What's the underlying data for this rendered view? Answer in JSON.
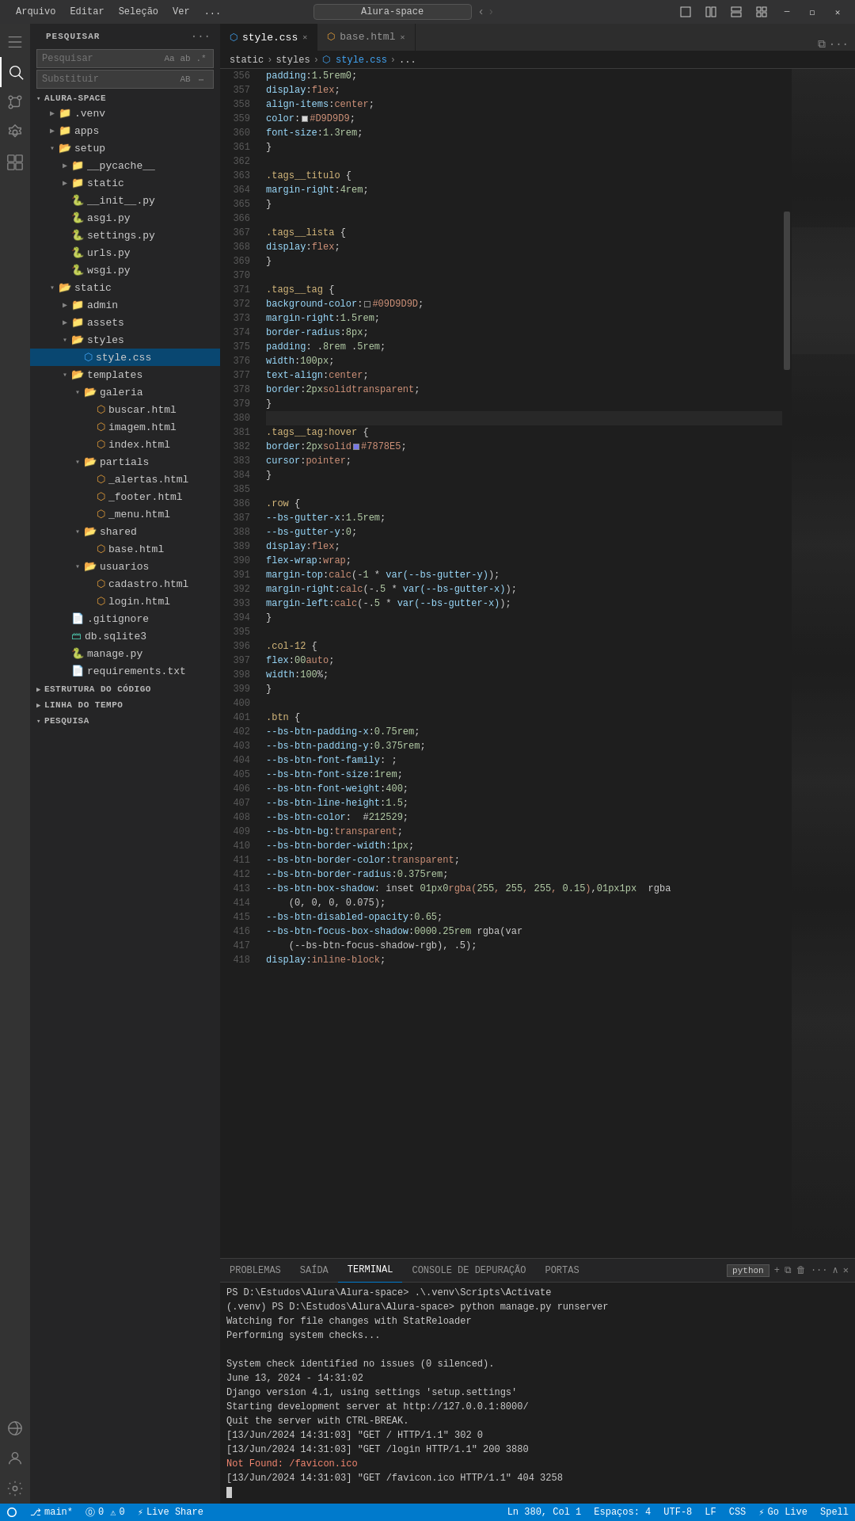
{
  "window": {
    "title": "Alura-space",
    "menu": [
      "Arquivo",
      "Editar",
      "Seleção",
      "Ver",
      "..."
    ]
  },
  "tabs": [
    {
      "id": "style.css",
      "label": "style.css",
      "icon": "css",
      "active": true,
      "dot": false
    },
    {
      "id": "base.html",
      "label": "base.html",
      "icon": "html",
      "active": false,
      "dot": false
    }
  ],
  "breadcrumb": [
    "static",
    "styles",
    "style.css",
    "..."
  ],
  "sidebar": {
    "title": "PESQUISAR",
    "search": {
      "placeholder": "Pesquisar",
      "value": ""
    },
    "replace": {
      "placeholder": "Substituir",
      "value": ""
    },
    "sections": {
      "estrutura": "ESTRUTURA DO CÓDIGO",
      "linha": "LINHA DO TEMPO",
      "pesquisa": "PESQUISA"
    }
  },
  "explorer": {
    "title": "ALURA-SPACE",
    "tree": [
      {
        "indent": 1,
        "open": true,
        "label": ".venv",
        "type": "folder"
      },
      {
        "indent": 1,
        "open": true,
        "label": "apps",
        "type": "folder"
      },
      {
        "indent": 1,
        "open": true,
        "label": "setup",
        "type": "folder"
      },
      {
        "indent": 2,
        "open": true,
        "label": "__pycache__",
        "type": "folder"
      },
      {
        "indent": 2,
        "open": true,
        "label": "static",
        "type": "folder"
      },
      {
        "indent": 2,
        "label": "__init__.py",
        "type": "py"
      },
      {
        "indent": 2,
        "label": "asgi.py",
        "type": "py"
      },
      {
        "indent": 2,
        "label": "settings.py",
        "type": "py"
      },
      {
        "indent": 2,
        "label": "urls.py",
        "type": "py"
      },
      {
        "indent": 2,
        "label": "wsgi.py",
        "type": "py"
      },
      {
        "indent": 1,
        "open": true,
        "label": "static",
        "type": "folder"
      },
      {
        "indent": 2,
        "open": true,
        "label": "admin",
        "type": "folder"
      },
      {
        "indent": 2,
        "open": true,
        "label": "assets",
        "type": "folder"
      },
      {
        "indent": 2,
        "open": true,
        "label": "styles",
        "type": "folder"
      },
      {
        "indent": 3,
        "label": "style.css",
        "type": "css",
        "active": true
      },
      {
        "indent": 2,
        "open": true,
        "label": "templates",
        "type": "folder"
      },
      {
        "indent": 3,
        "open": true,
        "label": "galeria",
        "type": "folder"
      },
      {
        "indent": 4,
        "label": "buscar.html",
        "type": "html"
      },
      {
        "indent": 4,
        "label": "imagem.html",
        "type": "html"
      },
      {
        "indent": 4,
        "label": "index.html",
        "type": "html"
      },
      {
        "indent": 3,
        "open": true,
        "label": "partials",
        "type": "folder"
      },
      {
        "indent": 4,
        "label": "_alertas.html",
        "type": "html"
      },
      {
        "indent": 4,
        "label": "_footer.html",
        "type": "html"
      },
      {
        "indent": 4,
        "label": "_menu.html",
        "type": "html"
      },
      {
        "indent": 3,
        "open": true,
        "label": "shared",
        "type": "folder"
      },
      {
        "indent": 4,
        "label": "base.html",
        "type": "html"
      },
      {
        "indent": 3,
        "open": true,
        "label": "usuarios",
        "type": "folder"
      },
      {
        "indent": 4,
        "label": "cadastro.html",
        "type": "html"
      },
      {
        "indent": 4,
        "label": "login.html",
        "type": "html"
      },
      {
        "indent": 2,
        "label": ".gitignore",
        "type": "file"
      },
      {
        "indent": 2,
        "label": "db.sqlite3",
        "type": "db"
      },
      {
        "indent": 2,
        "label": "manage.py",
        "type": "py"
      },
      {
        "indent": 2,
        "label": "requirements.txt",
        "type": "txt"
      }
    ]
  },
  "code": {
    "lines": [
      {
        "num": 356,
        "content": "  padding: 1.5rem 0;"
      },
      {
        "num": 357,
        "content": "  display: flex;"
      },
      {
        "num": 358,
        "content": "  align-items: center;"
      },
      {
        "num": 359,
        "content": "  color:  #D9D9D9;"
      },
      {
        "num": 360,
        "content": "  font-size: 1.3rem;"
      },
      {
        "num": 361,
        "content": "}"
      },
      {
        "num": 362,
        "content": ""
      },
      {
        "num": 363,
        "content": ".tags__titulo {"
      },
      {
        "num": 364,
        "content": "  margin-right: 4rem;"
      },
      {
        "num": 365,
        "content": "}"
      },
      {
        "num": 366,
        "content": ""
      },
      {
        "num": 367,
        "content": ".tags__lista {"
      },
      {
        "num": 368,
        "content": "  display: flex;"
      },
      {
        "num": 369,
        "content": "}"
      },
      {
        "num": 370,
        "content": ""
      },
      {
        "num": 371,
        "content": ".tags__tag {"
      },
      {
        "num": 372,
        "content": "  background-color:  #09D9D9D;"
      },
      {
        "num": 373,
        "content": "  margin-right: 1.5rem;"
      },
      {
        "num": 374,
        "content": "  border-radius: 8px;"
      },
      {
        "num": 375,
        "content": "  padding: .8rem .5rem;"
      },
      {
        "num": 376,
        "content": "  width: 100px;"
      },
      {
        "num": 377,
        "content": "  text-align: center;"
      },
      {
        "num": 378,
        "content": "  border: 2px solid transparent;"
      },
      {
        "num": 379,
        "content": "}"
      },
      {
        "num": 380,
        "content": ""
      },
      {
        "num": 381,
        "content": ".tags__tag:hover {"
      },
      {
        "num": 382,
        "content": "  border: 2px solid  #7878E5;"
      },
      {
        "num": 383,
        "content": "  cursor: pointer;"
      },
      {
        "num": 384,
        "content": "}"
      },
      {
        "num": 385,
        "content": ""
      },
      {
        "num": 386,
        "content": ".row {"
      },
      {
        "num": 387,
        "content": "  --bs-gutter-x: 1.5rem;"
      },
      {
        "num": 388,
        "content": "  --bs-gutter-y: 0;"
      },
      {
        "num": 389,
        "content": "  display: flex;"
      },
      {
        "num": 390,
        "content": "  flex-wrap: wrap;"
      },
      {
        "num": 391,
        "content": "  margin-top: calc(-1 * var(--bs-gutter-y));"
      },
      {
        "num": 392,
        "content": "  margin-right: calc(-.5 * var(--bs-gutter-x));"
      },
      {
        "num": 393,
        "content": "  margin-left: calc(-.5 * var(--bs-gutter-x));"
      },
      {
        "num": 394,
        "content": "}"
      },
      {
        "num": 395,
        "content": ""
      },
      {
        "num": 396,
        "content": ".col-12 {"
      },
      {
        "num": 397,
        "content": "  flex: 0 0 auto;"
      },
      {
        "num": 398,
        "content": "  width: 100%;"
      },
      {
        "num": 399,
        "content": "}"
      },
      {
        "num": 400,
        "content": ""
      },
      {
        "num": 401,
        "content": ".btn {"
      },
      {
        "num": 402,
        "content": "  --bs-btn-padding-x: 0.75rem;"
      },
      {
        "num": 403,
        "content": "  --bs-btn-padding-y: 0.375rem;"
      },
      {
        "num": 404,
        "content": "  --bs-btn-font-family: ;"
      },
      {
        "num": 405,
        "content": "  --bs-btn-font-size: 1rem;"
      },
      {
        "num": 406,
        "content": "  --bs-btn-font-weight: 400;"
      },
      {
        "num": 407,
        "content": "  --bs-btn-line-height: 1.5;"
      },
      {
        "num": 408,
        "content": "  --bs-btn-color:  #212529;"
      },
      {
        "num": 409,
        "content": "  --bs-btn-bg: transparent;"
      },
      {
        "num": 410,
        "content": "  --bs-btn-border-width: 1px;"
      },
      {
        "num": 411,
        "content": "  --bs-btn-border-color: transparent;"
      },
      {
        "num": 412,
        "content": "  --bs-btn-border-radius: 0.375rem;"
      },
      {
        "num": 413,
        "content": "  --bs-btn-box-shadow: inset 0 1px 0  rgba(255, 255, 255, 0.15),0 1px 1px  rgba"
      },
      {
        "num": 414,
        "content": "    (0, 0, 0, 0.075);"
      },
      {
        "num": 415,
        "content": "  --bs-btn-disabled-opacity: 0.65;"
      },
      {
        "num": 416,
        "content": "  --bs-btn-focus-box-shadow: 0 0 0 0.25rem rgba(var"
      },
      {
        "num": 417,
        "content": "    (--bs-btn-focus-shadow-rgb), .5);"
      },
      {
        "num": 418,
        "content": "  display: inline-block;"
      }
    ]
  },
  "terminal": {
    "tabs": [
      "PROBLEMAS",
      "SAÍDA",
      "TERMINAL",
      "CONSOLE DE DEPURAÇÃO",
      "PORTAS"
    ],
    "active_tab": "TERMINAL",
    "python_badge": "python",
    "lines": [
      {
        "type": "ps",
        "text": "PS D:\\Estudos\\Alura\\Alura-space> .\\.venv\\Scripts\\Activate"
      },
      {
        "type": "info",
        "text": "(.venv) PS D:\\Estudos\\Alura\\Alura-space> python manage.py runserver"
      },
      {
        "type": "info",
        "text": "Watching for file changes with StatReloader"
      },
      {
        "type": "info",
        "text": "Performing system checks..."
      },
      {
        "type": "blank",
        "text": ""
      },
      {
        "type": "success",
        "text": "System check identified no issues (0 silenced)."
      },
      {
        "type": "info",
        "text": "June 13, 2024 - 14:31:02"
      },
      {
        "type": "info",
        "text": "Django version 4.1, using settings 'setup.settings'"
      },
      {
        "type": "info",
        "text": "Starting development server at http://127.0.0.1:8000/"
      },
      {
        "type": "info",
        "text": "Quit the server with CTRL-BREAK."
      },
      {
        "type": "info",
        "text": "[13/Jun/2024 14:31:03] \"GET / HTTP/1.1\" 302 0"
      },
      {
        "type": "info",
        "text": "[13/Jun/2024 14:31:03] \"GET /login HTTP/1.1\" 200 3880"
      },
      {
        "type": "error",
        "text": "Not Found: /favicon.ico"
      },
      {
        "type": "info",
        "text": "[13/Jun/2024 14:31:03] \"GET /favicon.ico HTTP/1.1\" 404 3258"
      },
      {
        "type": "cursor",
        "text": ""
      }
    ]
  },
  "status_bar": {
    "left": [
      "⎇ main*",
      "⓪ 0  ⚠ 0",
      "⚡ Live Share"
    ],
    "right": [
      "Ln 380, Col 1",
      "Espaços: 4",
      "UTF-8",
      "LF",
      "CSS",
      "⚡ Go Live",
      "Spell"
    ]
  }
}
